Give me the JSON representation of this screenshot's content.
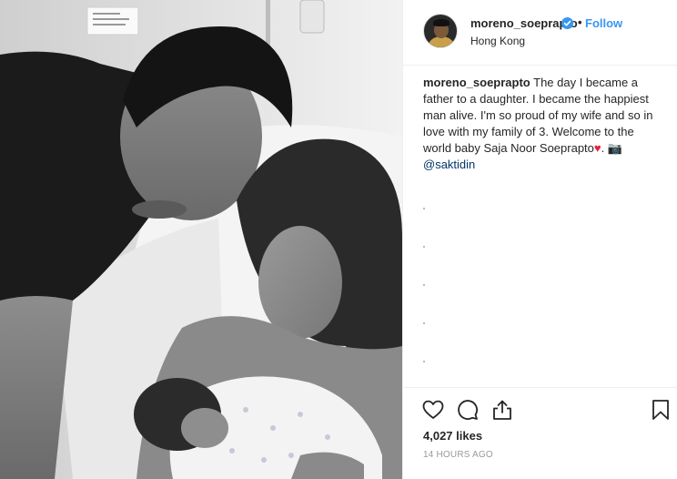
{
  "post": {
    "username": "moreno_soeprapto",
    "follow_label": "Follow",
    "separator": "•",
    "location": "Hong Kong",
    "caption": {
      "user": "moreno_soeprapto",
      "text": " The day I became a father to a daughter. I became the happiest man alive. I'm so proud of my wife and so in love with my family of 3. Welcome to the world baby Saja Noor Soeprapto",
      "heart": "♥",
      "after_heart": ". ",
      "camera": "📷",
      "mention": "@saktidin"
    },
    "likes": "4,027 likes",
    "timestamp": "14 HOURS AGO"
  },
  "icons": {
    "verified": "verified-badge-icon",
    "like": "heart-icon",
    "comment": "comment-icon",
    "share": "share-icon",
    "save": "bookmark-icon"
  },
  "colors": {
    "link_blue": "#3897f0",
    "mention": "#003569",
    "text": "#262626",
    "muted": "#999999",
    "border": "#efefef"
  }
}
